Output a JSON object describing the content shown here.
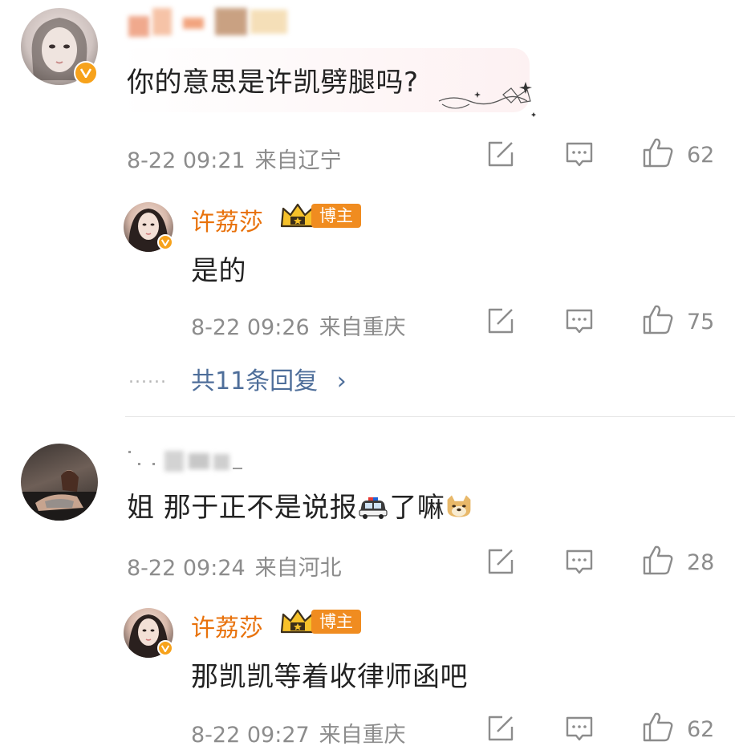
{
  "comments": [
    {
      "username_hidden": "",
      "text": "你的意思是许凯劈腿吗?",
      "time": "8-22 09:21",
      "location": "来自辽宁",
      "likes": "62",
      "reply": {
        "username": "许荔莎",
        "badge": "博主",
        "text": "是的",
        "time": "8-22 09:26",
        "location": "来自重庆",
        "likes": "75"
      },
      "more_replies": "共11条回复"
    },
    {
      "username_hidden": "",
      "text_before": "姐 那于正不是说报",
      "text_after": "了嘛",
      "time": "8-22 09:24",
      "location": "来自河北",
      "likes": "28",
      "reply": {
        "username": "许荔莎",
        "badge": "博主",
        "text": "那凯凯等着收律师函吧",
        "time": "8-22 09:27",
        "location": "来自重庆",
        "likes": "62"
      }
    }
  ],
  "icons": {
    "share": "share-icon",
    "comment": "comment-icon",
    "like": "thumbs-up-icon",
    "verified": "verified-v-icon",
    "crown": "crown-icon",
    "police_car_emoji": "police-car-icon",
    "doge_emoji": "doge-icon",
    "chevron": "chevron-right-icon"
  },
  "colors": {
    "blogger_name": "#e8720c",
    "badge_bg": "#f08c20",
    "link": "#4e6e9a",
    "meta": "#8c8c8c",
    "verified": "#f7a21b"
  },
  "more_replies_dots": "......",
  "chevron_glyph": "›"
}
